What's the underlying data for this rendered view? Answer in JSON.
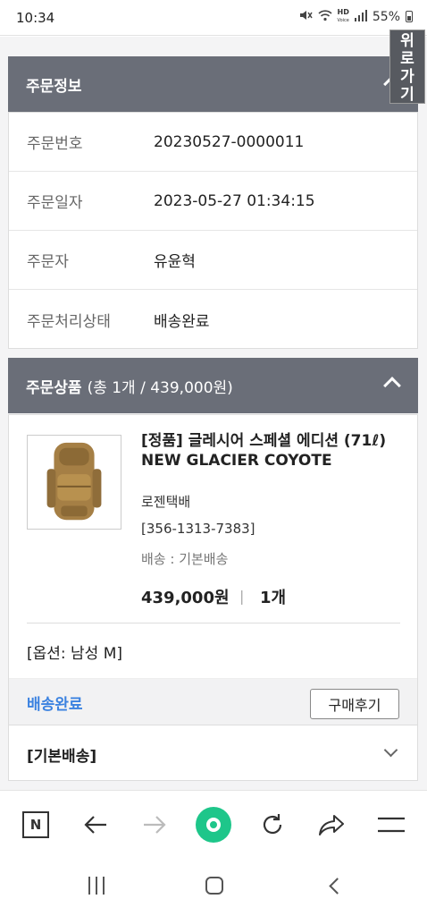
{
  "status_bar": {
    "time": "10:34",
    "battery": "55%",
    "hd_label": "HD",
    "hd_sub": "Voice"
  },
  "top_button": {
    "line1": "위",
    "line2": "로",
    "line3": "가",
    "line4": "기"
  },
  "order_info": {
    "header": "주문정보",
    "rows": [
      {
        "label": "주문번호",
        "value": "20230527-0000011"
      },
      {
        "label": "주문일자",
        "value": "2023-05-27 01:34:15"
      },
      {
        "label": "주문자",
        "value": "유윤혁"
      },
      {
        "label": "주문처리상태",
        "value": "배송완료"
      }
    ]
  },
  "order_products": {
    "header": "주문상품",
    "summary": "(총 1개 / 439,000원)",
    "product": {
      "title_line1": "[정품] 글레시어 스페셜 에디션 (71ℓ)",
      "title_line2": "NEW GLACIER COYOTE",
      "courier": "로젠택배",
      "tracking": "[356-1313-7383]",
      "shipping": "배송 : 기본배송",
      "price": "439,000원",
      "separator": "|",
      "quantity": "1개",
      "option": "[옵션: 남성 M]",
      "status": "배송완료",
      "review_button": "구매후기",
      "shipping_group": "[기본배송]"
    }
  },
  "browser_bar": {
    "n_label": "N"
  },
  "colors": {
    "header_bg": "#6a6e78",
    "status_blue": "#3b82e0",
    "green_button": "#1ec68a"
  }
}
